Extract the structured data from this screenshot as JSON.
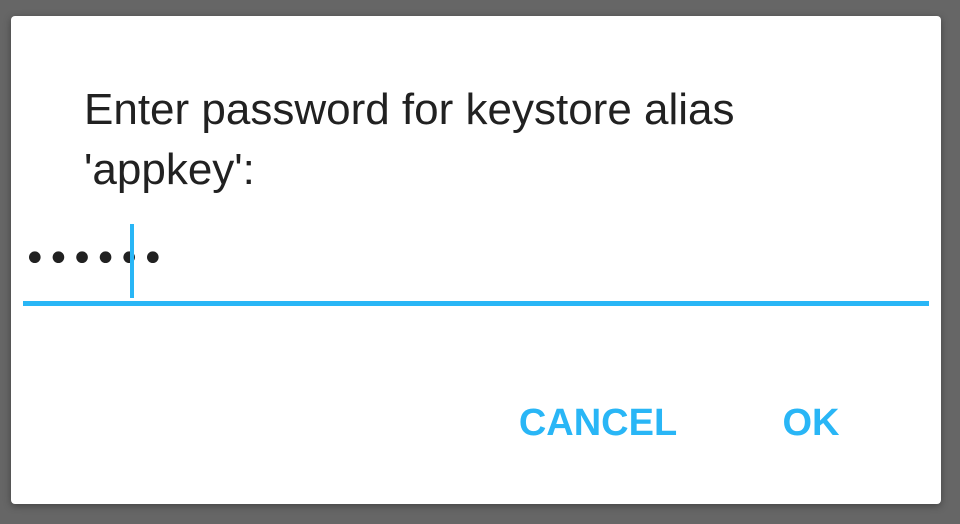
{
  "dialog": {
    "message": "Enter password for keystore alias 'appkey':",
    "password_field": {
      "masked_value": "••••••",
      "accent_color": "#29b6f6"
    },
    "buttons": {
      "cancel_label": "CANCEL",
      "ok_label": "OK"
    }
  },
  "colors": {
    "backdrop": "#666666",
    "surface": "#ffffff",
    "text": "#212121",
    "accent": "#29b6f6"
  }
}
